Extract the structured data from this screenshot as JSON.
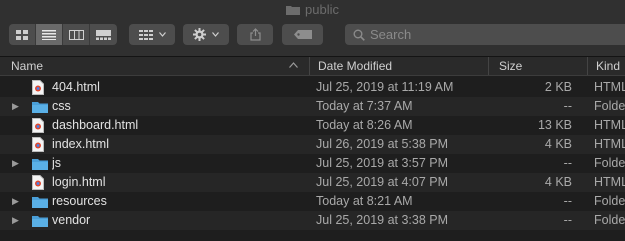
{
  "window": {
    "title": "public"
  },
  "toolbar": {
    "views": [
      "icon-view",
      "list-view",
      "column-view",
      "gallery-view"
    ],
    "active_view": "list-view",
    "search_placeholder": "Search"
  },
  "columns": {
    "name": "Name",
    "date": "Date Modified",
    "size": "Size",
    "kind": "Kind"
  },
  "colors": {
    "folder": "#4a9fd8",
    "background": "#1e1e1e",
    "toolbar": "#303030"
  },
  "rows": [
    {
      "name": "404.html",
      "date": "Jul 25, 2019 at 11:19 AM",
      "size": "2 KB",
      "kind": "HTML",
      "type": "file"
    },
    {
      "name": "css",
      "date": "Today at 7:37 AM",
      "size": "--",
      "kind": "Folder",
      "type": "folder"
    },
    {
      "name": "dashboard.html",
      "date": "Today at 8:26 AM",
      "size": "13 KB",
      "kind": "HTML",
      "type": "file"
    },
    {
      "name": "index.html",
      "date": "Jul 26, 2019 at 5:38 PM",
      "size": "4 KB",
      "kind": "HTML",
      "type": "file"
    },
    {
      "name": "js",
      "date": "Jul 25, 2019 at 3:57 PM",
      "size": "--",
      "kind": "Folder",
      "type": "folder"
    },
    {
      "name": "login.html",
      "date": "Jul 25, 2019 at 4:07 PM",
      "size": "4 KB",
      "kind": "HTML",
      "type": "file"
    },
    {
      "name": "resources",
      "date": "Today at 8:21 AM",
      "size": "--",
      "kind": "Folder",
      "type": "folder"
    },
    {
      "name": "vendor",
      "date": "Jul 25, 2019 at 3:38 PM",
      "size": "--",
      "kind": "Folder",
      "type": "folder"
    }
  ]
}
